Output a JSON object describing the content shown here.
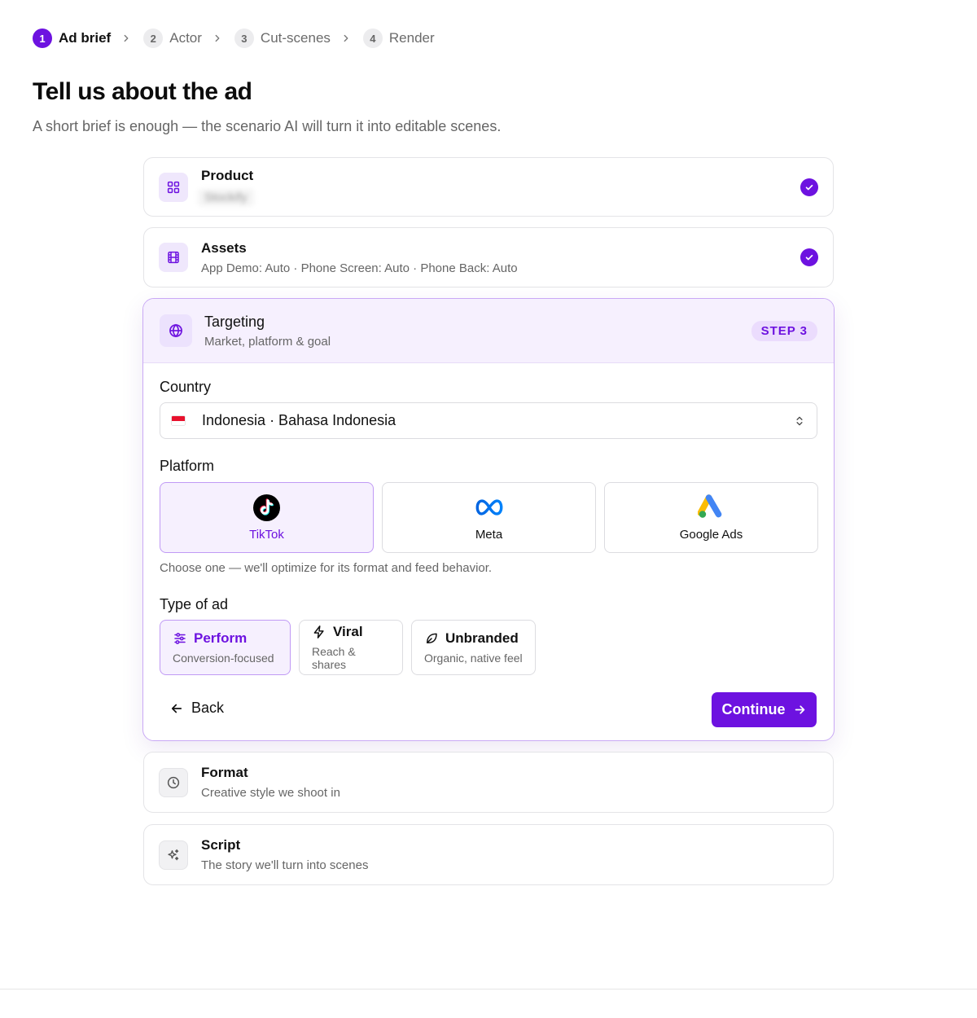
{
  "stepper": [
    {
      "num": "1",
      "label": "Ad brief",
      "active": true
    },
    {
      "num": "2",
      "label": "Actor",
      "active": false
    },
    {
      "num": "3",
      "label": "Cut-scenes",
      "active": false
    },
    {
      "num": "4",
      "label": "Render",
      "active": false
    }
  ],
  "page": {
    "title": "Tell us about the ad",
    "subtitle": "A short brief is enough — the scenario AI will turn it into editable scenes."
  },
  "sections": {
    "product": {
      "title": "Product",
      "subtitle": "Stockify",
      "icon": "grid-icon",
      "completed": true
    },
    "assets": {
      "title": "Assets",
      "subtitle": "App Demo: Auto · Phone Screen: Auto · Phone Back: Auto",
      "icon": "film-icon",
      "completed": true
    },
    "format": {
      "title": "Format",
      "subtitle": "Creative style we shoot in",
      "icon": "clock-icon"
    },
    "script": {
      "title": "Script",
      "subtitle": "The story we'll turn into scenes",
      "icon": "sparkle-icon"
    }
  },
  "targeting": {
    "title": "Targeting",
    "subtitle": "Market, platform & goal",
    "step_badge": "STEP 3",
    "icon": "globe-icon",
    "country": {
      "label": "Country",
      "value": "Indonesia · Bahasa Indonesia",
      "flag_icon": "indonesia-flag-icon"
    },
    "platform": {
      "label": "Platform",
      "options": [
        {
          "label": "TikTok",
          "icon": "tiktok-logo",
          "selected": true
        },
        {
          "label": "Meta",
          "icon": "meta-logo",
          "selected": false
        },
        {
          "label": "Google Ads",
          "icon": "google-ads-logo",
          "selected": false
        }
      ],
      "hint": "Choose one — we'll optimize for its format and feed behavior."
    },
    "ad_type": {
      "label": "Type of ad",
      "options": [
        {
          "name": "Perform",
          "desc": "Conversion-focused",
          "icon": "sliders-icon",
          "selected": true
        },
        {
          "name": "Viral",
          "desc": "Reach & shares",
          "icon": "lightning-icon",
          "selected": false
        },
        {
          "name": "Unbranded",
          "desc": "Organic, native feel",
          "icon": "leaf-icon",
          "selected": false
        }
      ]
    },
    "back_label": "Back",
    "continue_label": "Continue"
  },
  "colors": {
    "accent": "#6d12e0",
    "accent_soft": "#f6f0fe",
    "border": "#e4e4e7"
  }
}
